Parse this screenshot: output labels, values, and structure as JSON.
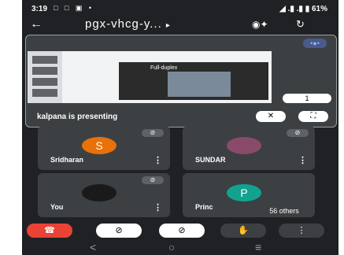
{
  "status": {
    "time": "3:19",
    "left_icons": "□ □ ▣ •",
    "right": "◢ .▮ .▮ ▮ 61%"
  },
  "topbar": {
    "back": "←",
    "title": "pgx-vhcg-y...",
    "arrow": "▸",
    "audio": "◉✦",
    "camswitch": "↻"
  },
  "presentation": {
    "label": "kalpana is presenting",
    "pager": "1",
    "more": "•●•",
    "slide_title": "Full-duplex"
  },
  "tiles": [
    {
      "name": "Sridharan",
      "initial": "S",
      "color": "#e8710a"
    },
    {
      "name": "SUNDAR",
      "initial": "",
      "color": "#8a4a6a"
    },
    {
      "name": "You",
      "initial": "",
      "color": "#1a1a1a"
    },
    {
      "name": "Princ",
      "initial": "P",
      "color": "#12a390"
    }
  ],
  "others_label": "56 others",
  "controls": {
    "end_call": "☎",
    "camera": "⊘",
    "mic": "⊘",
    "hand": "✋",
    "more": "⋮"
  },
  "navbar": {
    "back": "<",
    "home": "○",
    "recents": "≡"
  }
}
